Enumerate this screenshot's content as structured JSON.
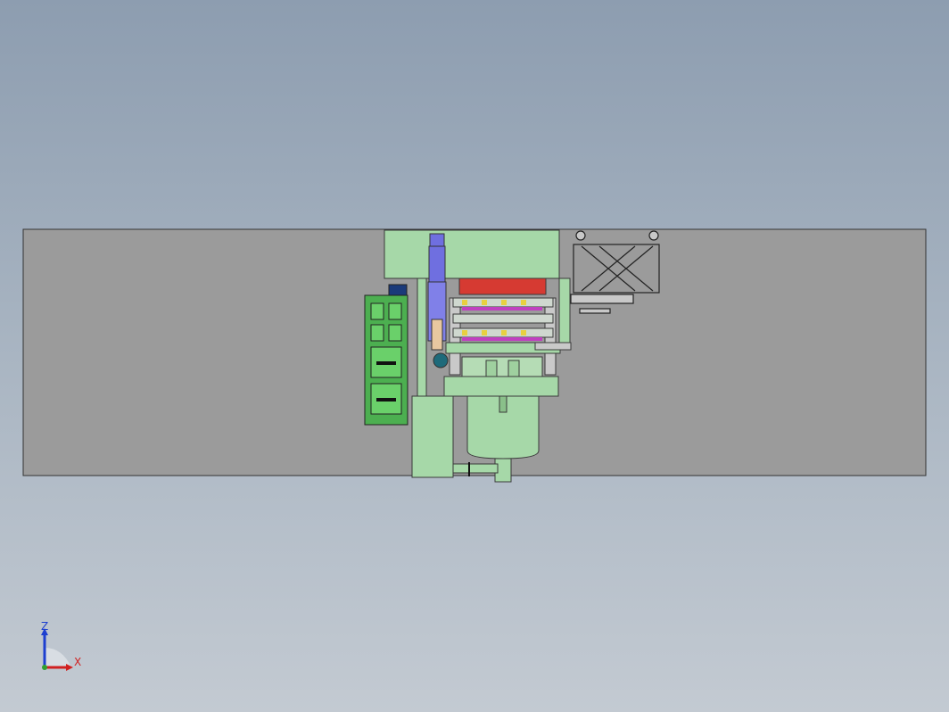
{
  "viewport": {
    "background_top": "#8d9db0",
    "background_bottom": "#c3cad2"
  },
  "model": {
    "floor_color": "#9b9b9b",
    "machine_color": "#a6d8a8",
    "panel_color": "#4caf50",
    "platen_color": "#d63a32",
    "operator_color": "#6f6fe0"
  },
  "triad": {
    "z_label": "Z",
    "x_label": "X",
    "z_color": "#1d3fd0",
    "x_color": "#d02020"
  }
}
